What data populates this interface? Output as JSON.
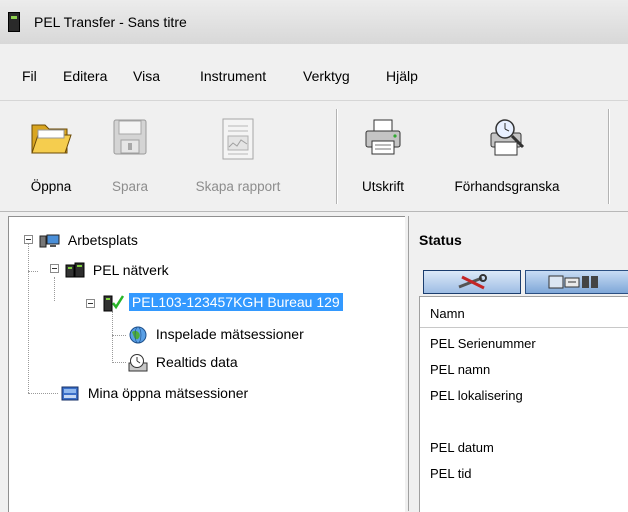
{
  "window": {
    "title": "PEL Transfer - Sans titre"
  },
  "menu": [
    "Fil",
    "Editera",
    "Visa",
    "Instrument",
    "Verktyg",
    "Hjälp"
  ],
  "toolbar": {
    "open": "Öppna",
    "save": "Spara",
    "report": "Skapa rapport",
    "print": "Utskrift",
    "preview": "Förhandsgranska"
  },
  "tree": {
    "workspace": "Arbetsplats",
    "network": "PEL nätverk",
    "device": "PEL103-123457KGH Bureau 129",
    "recorded": "Inspelade mätsessioner",
    "realtime": "Realtids data",
    "my_sessions": "Mina öppna mätsessioner"
  },
  "status": {
    "title": "Status",
    "column": "Namn",
    "rows": [
      "PEL Serienummer",
      "PEL namn",
      "PEL lokalisering",
      "",
      "PEL datum",
      "PEL tid"
    ]
  }
}
